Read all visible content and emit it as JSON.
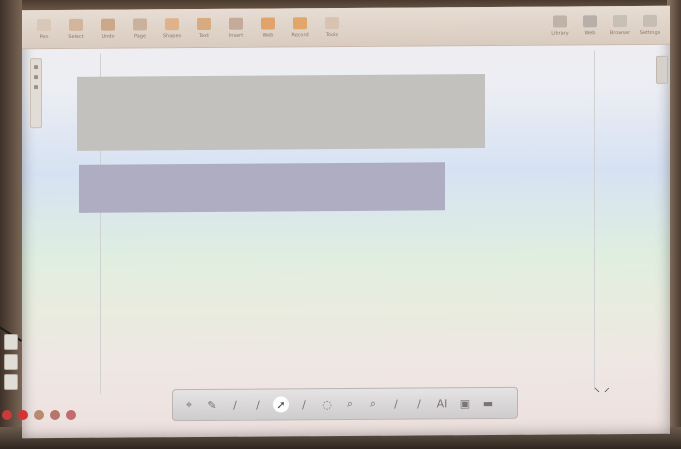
{
  "top_toolbar": {
    "buttons": [
      {
        "icon": "pen-icon",
        "label": "Pen",
        "color": "#d9c8b8"
      },
      {
        "icon": "square-icon",
        "label": "Select",
        "color": "#d2b59a"
      },
      {
        "icon": "arrows-icon",
        "label": "Undo",
        "color": "#caa889"
      },
      {
        "icon": "page-icon",
        "label": "Page",
        "color": "#c9b19b"
      },
      {
        "icon": "star-icon",
        "label": "Shapes",
        "color": "#e0b28a"
      },
      {
        "icon": "text-icon",
        "label": "Text",
        "color": "#d7aa80"
      },
      {
        "icon": "image-icon",
        "label": "Insert",
        "color": "#c4aa98"
      },
      {
        "icon": "globe-icon",
        "label": "Web",
        "color": "#e0a36c"
      },
      {
        "icon": "record-icon",
        "label": "Record",
        "color": "#e0a66a"
      },
      {
        "icon": "tools-icon",
        "label": "Tools",
        "color": "#d8c2b1"
      }
    ],
    "right_buttons": [
      {
        "icon": "resource-icon",
        "label": "Library",
        "color": "#bfb2a7"
      },
      {
        "icon": "globe-icon",
        "label": "Web",
        "color": "#b8b0a8"
      },
      {
        "icon": "folder-icon",
        "label": "Browser",
        "color": "#c8bfb6"
      },
      {
        "icon": "settings-icon",
        "label": "Settings",
        "color": "#c6bdb4"
      }
    ]
  },
  "canvas": {
    "gray_rect_color": "#c2c1bd",
    "blue_rect_color": "#aeadc1"
  },
  "bottom_toolbar": {
    "tools": [
      {
        "name": "cursor-icon",
        "glyph": "⌖"
      },
      {
        "name": "pen-icon",
        "glyph": "✎"
      },
      {
        "name": "marker-icon",
        "glyph": "∕"
      },
      {
        "name": "highlighter-icon",
        "glyph": "∕"
      },
      {
        "name": "select-icon",
        "glyph": "➚",
        "active": true
      },
      {
        "name": "eraser-icon",
        "glyph": "∕"
      },
      {
        "name": "fill-icon",
        "glyph": "◌"
      },
      {
        "name": "zoom-in-icon",
        "glyph": "⌕"
      },
      {
        "name": "zoom-out-icon",
        "glyph": "⌕"
      },
      {
        "name": "laser-icon",
        "glyph": "∕"
      },
      {
        "name": "line-icon",
        "glyph": "∕"
      },
      {
        "name": "text-icon",
        "glyph": "AI"
      },
      {
        "name": "image-icon",
        "glyph": "▣"
      },
      {
        "name": "more-icon",
        "glyph": "▬"
      }
    ]
  },
  "tray_colors": [
    "#c93b3b",
    "#d43434",
    "#b98a72",
    "#b57568",
    "#c46b6b"
  ]
}
